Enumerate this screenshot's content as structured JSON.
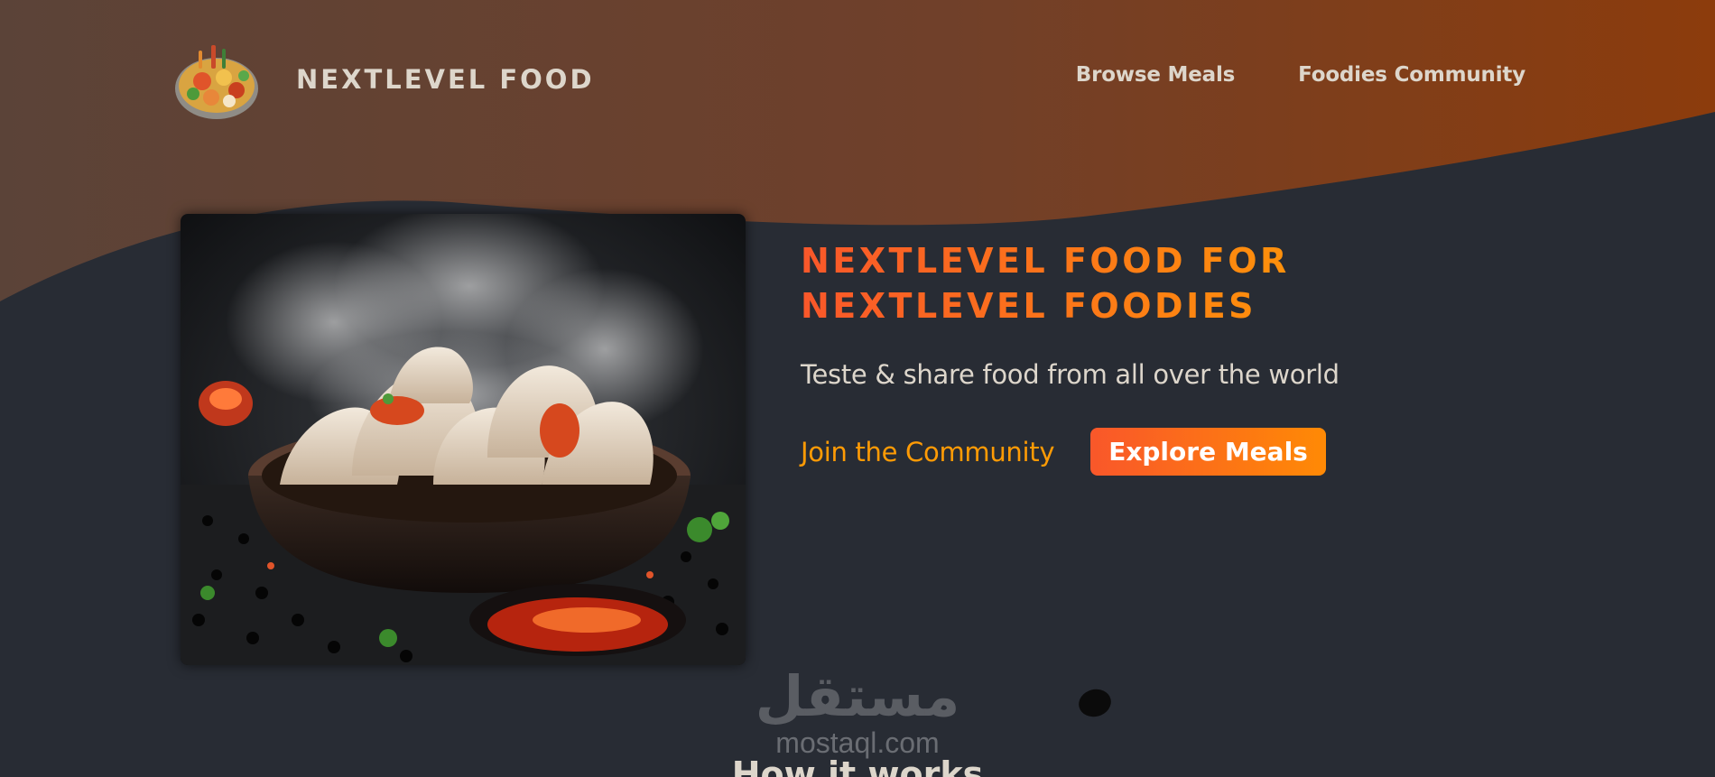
{
  "header": {
    "logo_alt": "A plate with food on it",
    "logo_text": "NEXTLEVEL FOOD",
    "nav": [
      {
        "label": "Browse Meals"
      },
      {
        "label": "Foodies Community"
      }
    ]
  },
  "hero": {
    "image_alt": "Steaming dumplings in a dark bowl with chili sauce",
    "title_line1": "NEXTLEVEL FOOD FOR",
    "title_line2": "NEXTLEVEL FOODIES",
    "subtitle": "Teste & share food from all over the world",
    "join_label": "Join the Community",
    "explore_label": "Explore Meals"
  },
  "watermark": {
    "arabic": "مستقل",
    "latin": "mostaql.com"
  },
  "section": {
    "title": "How it works"
  },
  "colors": {
    "background": "#282c34",
    "header_gradient_start": "#5b4338",
    "header_gradient_end": "#8a3c0c",
    "accent_orange": "#f9572a",
    "accent_amber": "#ff9b05",
    "text_light": "#ddd6cb"
  }
}
